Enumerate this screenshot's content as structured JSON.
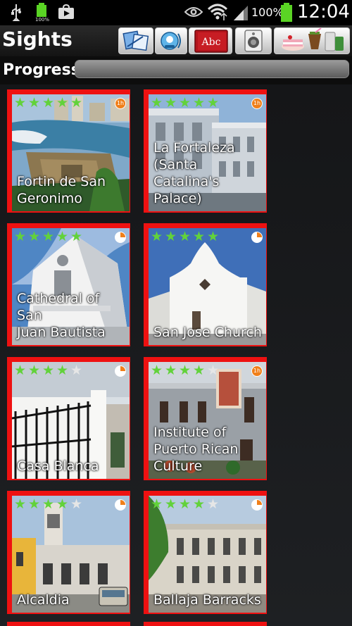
{
  "status_bar": {
    "battery_percent": "100%",
    "small_battery_label": "100%",
    "time": "12:04"
  },
  "header": {
    "title": "Sights",
    "toolbar": [
      {
        "name": "translate-icon"
      },
      {
        "name": "audio-icon"
      },
      {
        "name": "dictionary-icon"
      },
      {
        "name": "speaker-icon"
      },
      {
        "name": "food-drink-icon"
      }
    ]
  },
  "progress": {
    "label": "Progress",
    "value": 0
  },
  "colors": {
    "card_border": "#ee1111",
    "star_on": "#62d23a",
    "star_off": "#e6e6e6",
    "badge": "#f07f1a"
  },
  "sights": [
    {
      "name": "Fortin de San\nGeronimo",
      "stars": 5,
      "badge": "1h"
    },
    {
      "name": "La Fortaleza\n(Santa Catalina's\nPalace)",
      "stars": 5,
      "badge": "1h"
    },
    {
      "name": "Cathedral of San\nJuan Bautista",
      "stars": 5,
      "badge": "quarter"
    },
    {
      "name": "San Jose Church",
      "stars": 5,
      "badge": "quarter"
    },
    {
      "name": "Casa Blanca",
      "stars": 4,
      "badge": "quarter"
    },
    {
      "name": "Institute of\nPuerto Rican\nCulture",
      "stars": 4,
      "badge": "1h"
    },
    {
      "name": "Alcaldia",
      "stars": 4,
      "badge": "quarter"
    },
    {
      "name": "Ballaja Barracks",
      "stars": 4,
      "badge": "quarter"
    }
  ]
}
